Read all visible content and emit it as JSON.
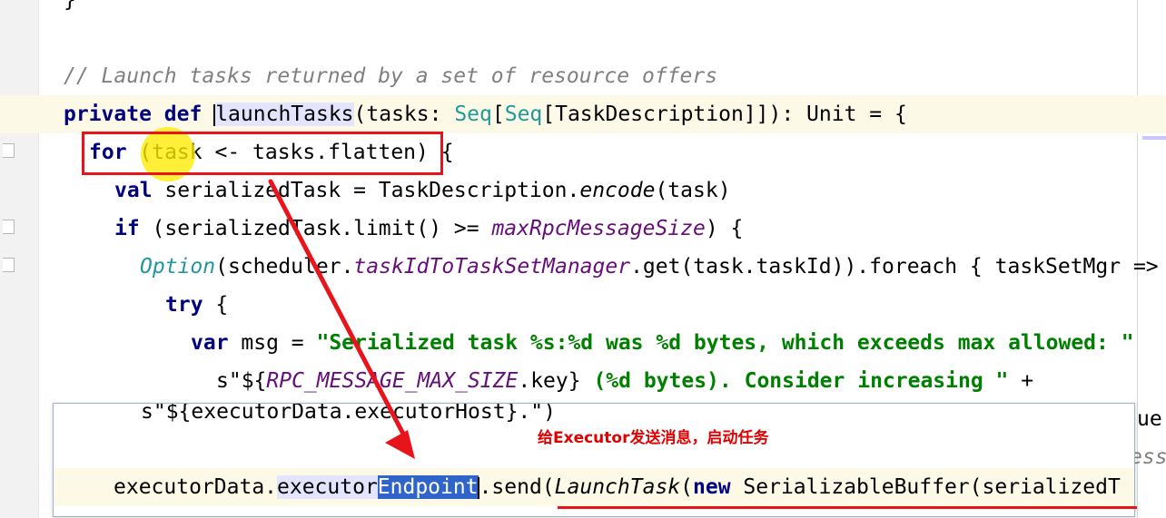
{
  "editor": {
    "lines": [
      {
        "tokens": [
          {
            "t": "}",
            "c": ""
          }
        ]
      },
      {
        "tokens": []
      },
      {
        "tokens": [
          {
            "t": "// Launch tasks returned by a set of resource offers",
            "c": "cm"
          }
        ]
      },
      {
        "tokens": [
          {
            "t": "private",
            "c": "kw"
          },
          {
            "t": " ",
            "c": ""
          },
          {
            "t": "def",
            "c": "kw"
          },
          {
            "t": " ",
            "c": ""
          },
          {
            "t": "launchTasks",
            "c": "ref"
          },
          {
            "t": "(tasks: ",
            "c": ""
          },
          {
            "t": "Seq",
            "c": "tp"
          },
          {
            "t": "[",
            "c": ""
          },
          {
            "t": "Seq",
            "c": "tp"
          },
          {
            "t": "[TaskDescription]]): Unit = {",
            "c": ""
          }
        ]
      },
      {
        "tokens": [
          {
            "t": "for",
            "c": "kw"
          },
          {
            "t": " (task <- tasks.flatten) {",
            "c": ""
          }
        ]
      },
      {
        "tokens": [
          {
            "t": "val",
            "c": "kw"
          },
          {
            "t": " serializedTask = TaskDescription.",
            "c": ""
          },
          {
            "t": "encode",
            "c": "it"
          },
          {
            "t": "(task)",
            "c": ""
          }
        ]
      },
      {
        "tokens": [
          {
            "t": "if",
            "c": "kw"
          },
          {
            "t": " (serializedTask.limit() >= ",
            "c": ""
          },
          {
            "t": "maxRpcMessageSize",
            "c": "fld"
          },
          {
            "t": ") {",
            "c": ""
          }
        ]
      },
      {
        "tokens": [
          {
            "t": "Option",
            "c": "it tp"
          },
          {
            "t": "(scheduler.",
            "c": ""
          },
          {
            "t": "taskIdToTaskSetManager",
            "c": "fld"
          },
          {
            "t": ".get(task.taskId)).foreach { taskSetMgr =>",
            "c": ""
          }
        ]
      },
      {
        "tokens": [
          {
            "t": "try",
            "c": "kw"
          },
          {
            "t": " {",
            "c": ""
          }
        ]
      },
      {
        "tokens": [
          {
            "t": "var",
            "c": "kw"
          },
          {
            "t": " msg = ",
            "c": ""
          },
          {
            "t": "\"Serialized task %s:%d was %d bytes, which exceeds max allowed: \"",
            "c": "str"
          }
        ]
      },
      {
        "tokens": [
          {
            "t": "s\"${",
            "c": ""
          },
          {
            "t": "RPC_MESSAGE_MAX_SIZE",
            "c": "fld"
          },
          {
            "t": ".key} ",
            "c": ""
          },
          {
            "t": "(%d bytes). Consider increasing \"",
            "c": "str"
          },
          {
            "t": " +",
            "c": ""
          }
        ]
      }
    ],
    "behind_popup_right": [
      "ue",
      "ess"
    ]
  },
  "popup": {
    "partial_line": "s\"${executorData.executorHost}.\")",
    "annotation": "给Executor发送消息，启动任务",
    "code_tokens": [
      {
        "t": "executorData.",
        "c": ""
      },
      {
        "t": "executor",
        "c": "ref"
      },
      {
        "t": "Endpoint",
        "c": "sel"
      },
      {
        "t": ".send(",
        "c": ""
      },
      {
        "t": "LaunchTask",
        "c": "it"
      },
      {
        "t": "(",
        "c": ""
      },
      {
        "t": "new",
        "c": "kw"
      },
      {
        "t": " SerializableBuffer(serializedT",
        "c": ""
      }
    ]
  },
  "colors": {
    "annotation_red": "#e8141c",
    "highlight_line": "#fcfae6",
    "keyword": "#000080",
    "string": "#008000",
    "selection": "#2f65ca",
    "cursor_dot": "#ffeb00"
  }
}
